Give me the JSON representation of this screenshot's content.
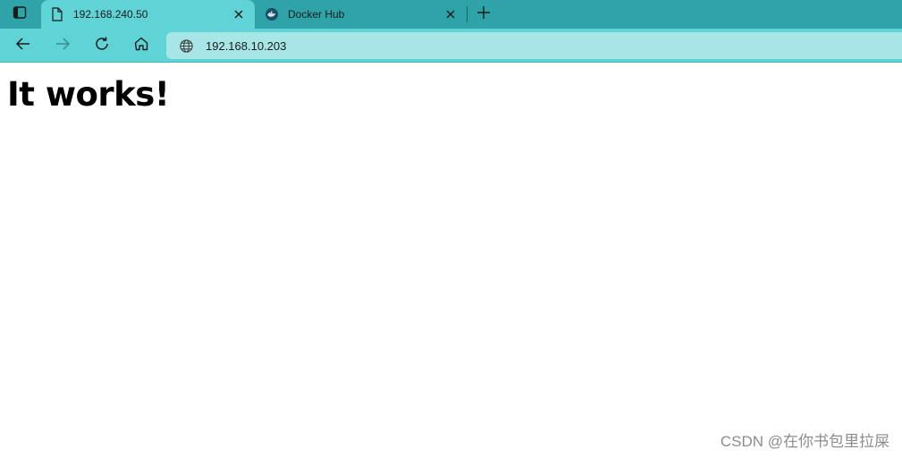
{
  "tabs": [
    {
      "title": "192.168.240.50",
      "icon": "page-icon",
      "active": true
    },
    {
      "title": "Docker Hub",
      "icon": "docker-icon",
      "active": false
    }
  ],
  "address": {
    "url": "192.168.10.203"
  },
  "page": {
    "heading": "It works!"
  },
  "watermark": "CSDN @在你书包里拉屎",
  "colors": {
    "tabstrip": "#2fa4a8",
    "active_tab": "#5fd3d6",
    "toolbar": "#5fd3d6",
    "addressbar": "#a6e6e7"
  }
}
